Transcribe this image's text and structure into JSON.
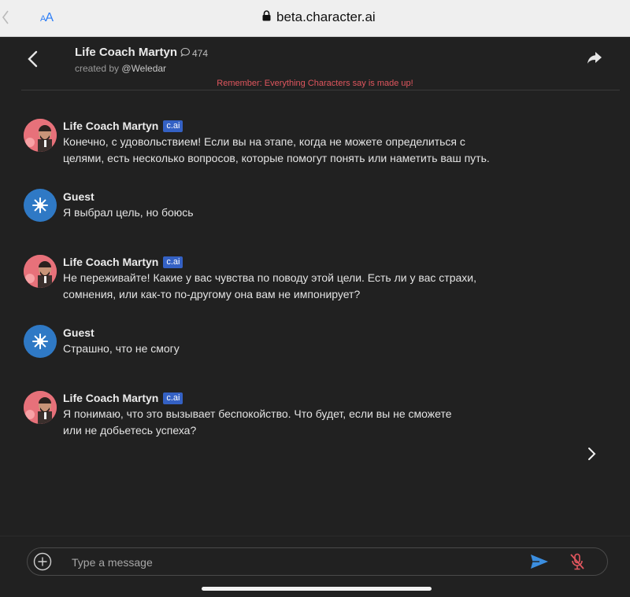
{
  "browser": {
    "aa_small": "A",
    "aa_large": "A",
    "url": "beta.character.ai"
  },
  "header": {
    "character_name": "Life Coach Martyn",
    "chat_count": "474",
    "created_by_prefix": "created by",
    "author": "@Weledar",
    "disclaimer": "Remember: Everything Characters say is made up!"
  },
  "messages": [
    {
      "author": "Life Coach Martyn",
      "badge": "c.ai",
      "is_bot": true,
      "text": "Конечно, с удовольствием! Если вы на этапе, когда не можете определиться с\nцелями, есть несколько вопросов, которые помогут понять или наметить ваш путь."
    },
    {
      "author": "Guest",
      "is_bot": false,
      "text": "Я выбрал цель, но боюсь"
    },
    {
      "author": "Life Coach Martyn",
      "badge": "c.ai",
      "is_bot": true,
      "text": "Не переживайте! Какие у вас чувства по поводу этой цели. Есть ли у вас страхи,\nсомнения, или как-то по-другому она вам не импонирует?"
    },
    {
      "author": "Guest",
      "is_bot": false,
      "text": "Страшно, что не смогу"
    },
    {
      "author": "Life Coach Martyn",
      "badge": "c.ai",
      "is_bot": true,
      "text": "Я понимаю, что это вызывает беспокойство. Что будет, если вы не сможете\nили не добьетесь успеха?"
    }
  ],
  "composer": {
    "placeholder": "Type a message"
  },
  "colors": {
    "background": "#212121",
    "accent_blue": "#3461c4",
    "send_blue": "#3b8ee0",
    "disclaimer_red": "#e0565e",
    "mic_red": "#e0565e"
  }
}
